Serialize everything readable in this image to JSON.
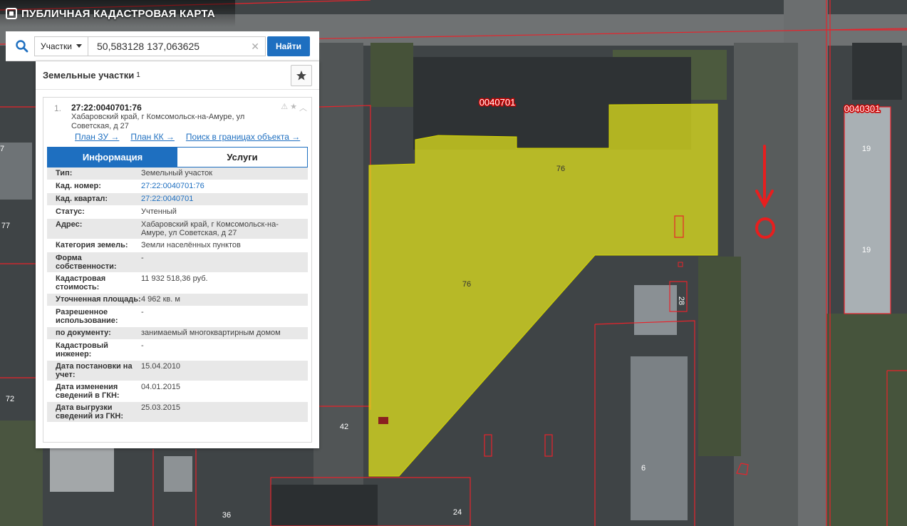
{
  "header": {
    "title": "ПУБЛИЧНАЯ КАДАСТРОВАЯ КАРТА"
  },
  "search": {
    "category": "Участки",
    "query": "50,583128 137,063625",
    "find_label": "Найти"
  },
  "results": {
    "title": "Земельные участки",
    "count": "1"
  },
  "item": {
    "index": "1.",
    "cad_number": "27:22:0040701:76",
    "address": "Хабаровский край, г Комсомольск-на-Амуре, ул Советская, д 27",
    "links": [
      "План ЗУ →",
      "План КК →",
      "Поиск в границах объекта →"
    ],
    "tabs": [
      "Информация",
      "Услуги"
    ],
    "fields": [
      {
        "k": "Тип:",
        "v": "Земельный участок"
      },
      {
        "k": "Кад. номер:",
        "v": "27:22:0040701:76"
      },
      {
        "k": "Кад. квартал:",
        "v": "27:22:0040701"
      },
      {
        "k": "Статус:",
        "v": "Учтенный"
      },
      {
        "k": "Адрес:",
        "v": "Хабаровский край, г Комсомольск-на-Амуре, ул Советская, д 27"
      },
      {
        "k": "Категория земель:",
        "v": "Земли населённых пунктов"
      },
      {
        "k": "Форма собственности:",
        "v": "-"
      },
      {
        "k": "Кадастровая стоимость:",
        "v": "11 932 518,36 руб."
      },
      {
        "k": "Уточненная площадь:",
        "v": "4 962 кв. м"
      },
      {
        "k": "Разрешенное использование:",
        "v": "-"
      },
      {
        "k": "по документу:",
        "v": "занимаемый многоквартирным домом"
      },
      {
        "k": "Кадастровый инженер:",
        "v": "-"
      },
      {
        "k": "Дата постановки на учет:",
        "v": "15.04.2010"
      },
      {
        "k": "Дата изменения сведений в ГКН:",
        "v": "04.01.2015"
      },
      {
        "k": "Дата выгрузки сведений из ГКН:",
        "v": "25.03.2015"
      }
    ]
  },
  "map_labels": {
    "quarter_main": "0040701",
    "quarter_right": "0040301",
    "parcel_a": "76",
    "parcel_b": "76",
    "bldg_19a": "19",
    "bldg_19b": "19",
    "n28": "28",
    "n42": "42",
    "n6": "6",
    "n36": "36",
    "n24": "24",
    "n72": "72",
    "n77": "77",
    "n7": "7"
  }
}
